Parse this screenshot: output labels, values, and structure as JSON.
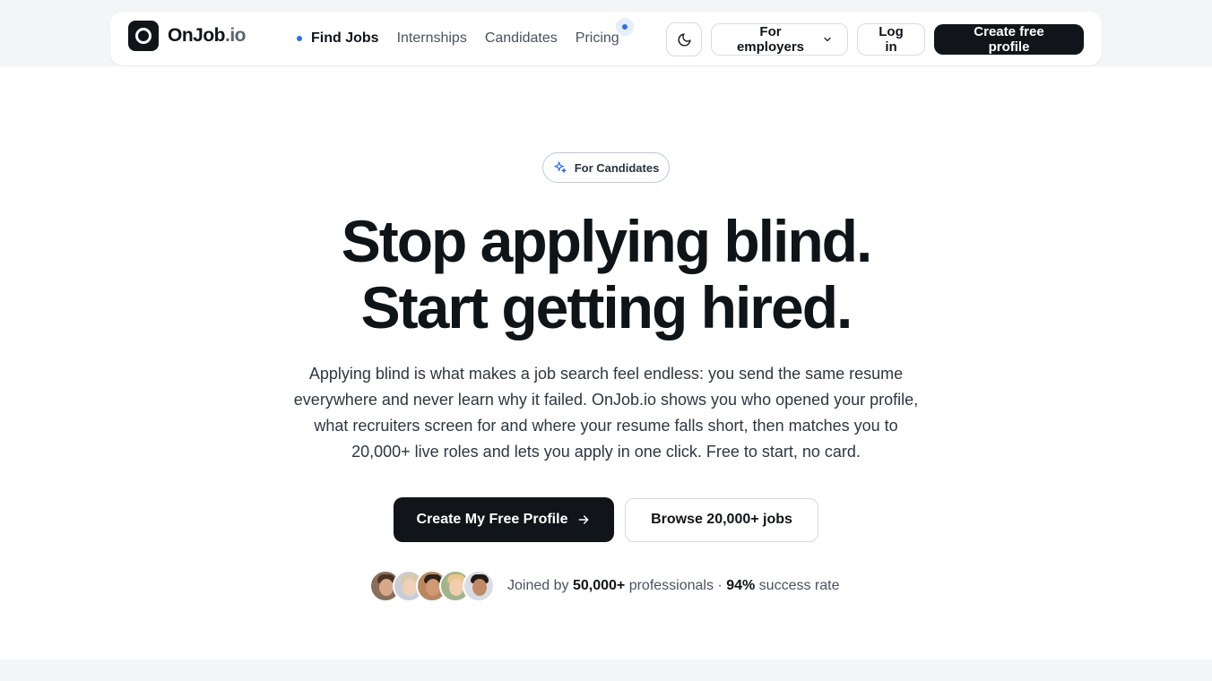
{
  "brand": {
    "name": "OnJob",
    "tld": ".io"
  },
  "nav": {
    "links": [
      {
        "label": "Find Jobs",
        "active": true
      },
      {
        "label": "Internships"
      },
      {
        "label": "Candidates"
      },
      {
        "label": "Pricing"
      }
    ],
    "employers_label": "For employers",
    "login_label": "Log in",
    "signup_label": "Create free profile"
  },
  "hero": {
    "badge": "For Candidates",
    "headline_line1": "Stop applying blind.",
    "headline_line2": "Start getting hired.",
    "subtext": "Applying blind is what makes a job search feel endless: you send the same resume everywhere and never learn why it failed. OnJob.io shows you who opened your profile, what recruiters screen for and where your resume falls short, then matches you to 20,000+ live roles and lets you apply in one click. Free to start, no card.",
    "cta_primary": "Create My Free Profile",
    "cta_secondary": "Browse 20,000+ jobs"
  },
  "social_proof": {
    "prefix": "Joined by",
    "members": "50,000+",
    "members_suffix": "professionals ·",
    "rate": "94%",
    "rate_suffix": "success rate"
  },
  "icons": {
    "theme": "moon-icon",
    "badge": "sparkle-icon",
    "cta": "arrow-right-icon",
    "dropdown": "chevron-down-icon"
  },
  "colors": {
    "accent": "#2f6fe4",
    "dark": "#111418",
    "band": "#f3f5f8"
  }
}
